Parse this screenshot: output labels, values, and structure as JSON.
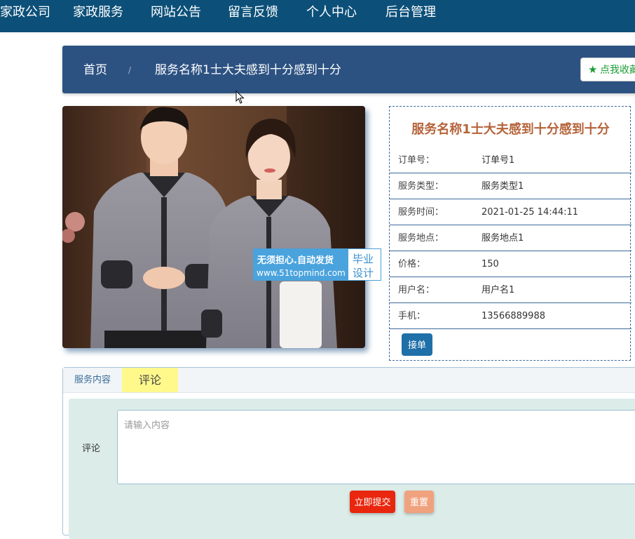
{
  "nav": {
    "items": [
      "家政公司",
      "家政服务",
      "网站公告",
      "留言反馈",
      "个人中心",
      "后台管理"
    ]
  },
  "breadcrumb": {
    "home": "首页",
    "separator": "/",
    "current": "服务名称1士大夫感到十分感到十分"
  },
  "favorite_button": "点我收藏",
  "watermark": {
    "line1": "无须担心.自动发货",
    "url": "www.51topmind.com",
    "side1": "毕业",
    "side2": "设计"
  },
  "detail": {
    "title": "服务名称1士大夫感到十分感到十分",
    "fields": [
      {
        "label": "订单号：",
        "value": "订单号1"
      },
      {
        "label": "服务类型：",
        "value": "服务类型1"
      },
      {
        "label": "服务时间：",
        "value": "2021-01-25 14:44:11"
      },
      {
        "label": "服务地点：",
        "value": "服务地点1"
      },
      {
        "label": "价格：",
        "value": "150"
      },
      {
        "label": "用户名：",
        "value": "用户名1"
      },
      {
        "label": "手机：",
        "value": "13566889988"
      }
    ],
    "accept_button": "接单"
  },
  "tabs": {
    "content": "服务内容",
    "comment": "评论"
  },
  "comment_form": {
    "label": "评论",
    "placeholder": "请输入内容",
    "submit": "立即提交",
    "reset": "重置"
  },
  "colors": {
    "nav_bg": "#0c5079",
    "breadcrumb_bg": "#2c5282",
    "title_color": "#b5633a",
    "submit_bg": "#e8270e",
    "reset_bg": "#f0a27f",
    "accept_bg": "#1f6fa8",
    "active_tab_bg": "#fff98c"
  }
}
